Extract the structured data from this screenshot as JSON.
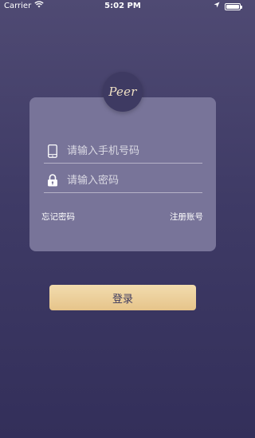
{
  "status_bar": {
    "carrier": "Carrier",
    "time": "5:02 PM",
    "icons": [
      "wifi-icon",
      "location-arrow-icon",
      "battery-icon"
    ]
  },
  "logo": {
    "text": "Peer"
  },
  "login_form": {
    "phone_placeholder": "请输入手机号码",
    "phone_value": "",
    "password_placeholder": "请输入密码",
    "password_value": "",
    "phone_icon": "phone-icon",
    "password_icon": "lock-icon",
    "forgot_password": "忘记密码",
    "register": "注册账号"
  },
  "login_button": {
    "label": "登录"
  },
  "colors": {
    "background_top": "#4f4a73",
    "background_bottom": "#332f5a",
    "card": "#787499",
    "button_gold": "#e6c48a",
    "logo_bg": "#3e3a62"
  }
}
